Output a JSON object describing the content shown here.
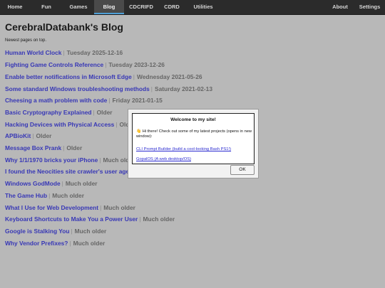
{
  "nav": {
    "items": [
      {
        "label": "Home"
      },
      {
        "label": "Fun"
      },
      {
        "label": "Games"
      },
      {
        "label": "Blog"
      },
      {
        "label": "CDCRIFD"
      },
      {
        "label": "CDRD"
      },
      {
        "label": "Utilities"
      },
      {
        "label": "About"
      },
      {
        "label": "Settings"
      }
    ],
    "active": "Blog"
  },
  "page": {
    "title": "CerebralDatabank's Blog",
    "subtitle": "Newest pages on top."
  },
  "posts": [
    {
      "title": "Human World Clock",
      "date": "Tuesday 2025-12-16"
    },
    {
      "title": "Fighting Game Controls Reference",
      "date": "Tuesday 2023-12-26"
    },
    {
      "title": "Enable better notifications in Microsoft Edge",
      "date": "Wednesday 2021-05-26"
    },
    {
      "title": "Some standard Windows troubleshooting methods",
      "date": "Saturday 2021-02-13"
    },
    {
      "title": "Cheesing a math problem with code",
      "date": "Friday 2021-01-15"
    },
    {
      "title": "Basic Cryptography Explained",
      "date": "Older"
    },
    {
      "title": "Hacking Devices with Physical Access",
      "date": "Older"
    },
    {
      "title": "APBioKit",
      "date": "Older"
    },
    {
      "title": "Message Box Prank",
      "date": "Older"
    },
    {
      "title": "Why 1/1/1970 bricks your iPhone",
      "date": "Much older"
    },
    {
      "title": "I found the Neocities site crawler's user age",
      "date": ""
    },
    {
      "title": "Windows GodMode",
      "date": "Much older"
    },
    {
      "title": "The Game Hub",
      "date": "Much older"
    },
    {
      "title": "What I Use for Web Development",
      "date": "Much older"
    },
    {
      "title": "Keyboard Shortcuts to Make You a Power User",
      "date": "Much older"
    },
    {
      "title": "Google is Stalking You",
      "date": "Much older"
    },
    {
      "title": "Why Vendor Prefixes?",
      "date": "Much older"
    }
  ],
  "modal": {
    "title": "Welcome to my site!",
    "wave_icon": "waving-hand-icon",
    "message": "Hi there! Check out some of my latest projects (opens in new window):",
    "links": [
      {
        "label": "CLI Prompt Builder (build a cool-looking Bash PS1!)"
      },
      {
        "label": "GopalOS (A web desktop/OS)"
      }
    ],
    "ok_label": "OK"
  },
  "colors": {
    "nav_bg": "#2b2b2b",
    "accent": "#4fa0d8",
    "link": "#3838b6",
    "overlay_bg": "#b8b8b8"
  }
}
